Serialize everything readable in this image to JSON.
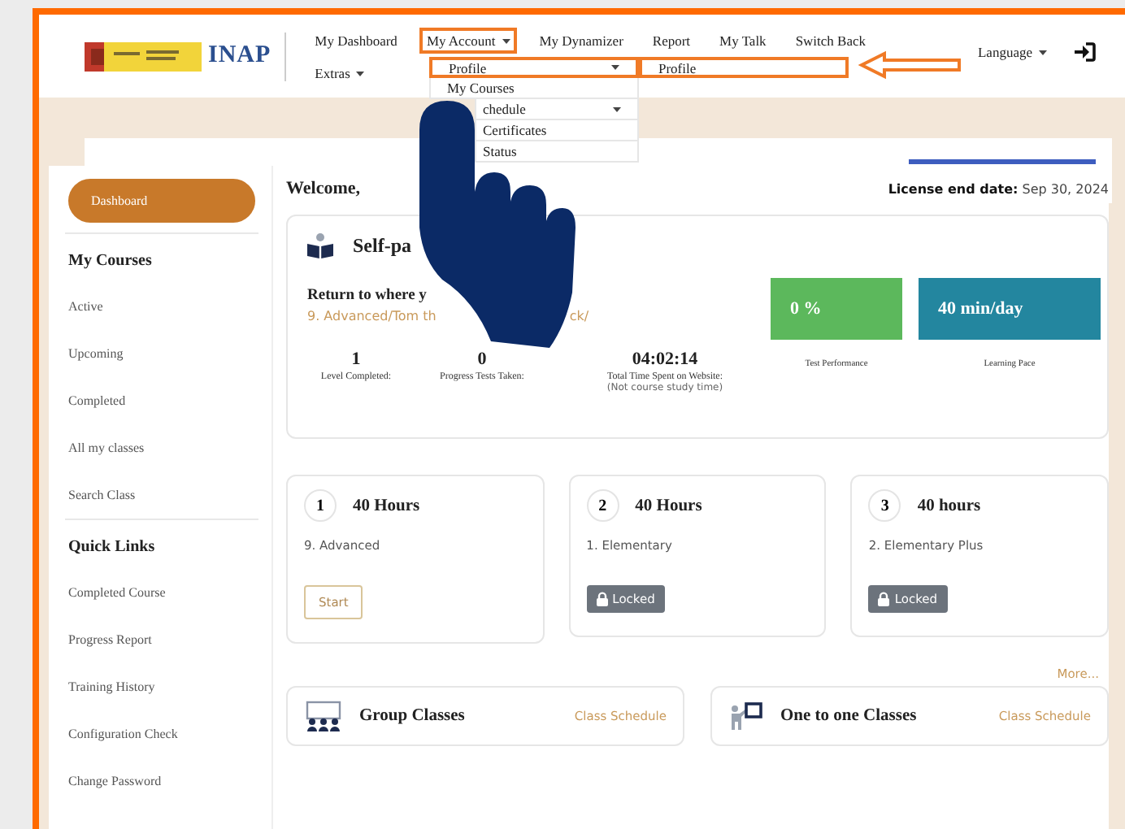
{
  "header": {
    "logo_text": "INAP",
    "nav": [
      {
        "label": "My Dashboard",
        "has_caret": false,
        "highlighted": false
      },
      {
        "label": "My Account",
        "has_caret": true,
        "highlighted": true
      },
      {
        "label": "My Dynamizer",
        "has_caret": false,
        "highlighted": false
      },
      {
        "label": "Report",
        "has_caret": false,
        "highlighted": false
      },
      {
        "label": "My Talk",
        "has_caret": false,
        "highlighted": false
      },
      {
        "label": "Switch Back",
        "has_caret": false,
        "highlighted": false
      }
    ],
    "nav_second_row": [
      {
        "label": "Extras",
        "has_caret": true,
        "highlighted": false
      }
    ],
    "language": "Language"
  },
  "dropdown": {
    "items": [
      {
        "label": "Profile",
        "has_caret": true,
        "highlighted": true,
        "covered": false
      },
      {
        "label": "My Courses",
        "has_caret": false,
        "highlighted": false,
        "covered": false
      },
      {
        "label": "chedule",
        "has_caret": true,
        "highlighted": false,
        "covered": true
      },
      {
        "label": "Certificates",
        "has_caret": false,
        "highlighted": false,
        "covered": true
      },
      {
        "label": "Status",
        "has_caret": false,
        "highlighted": false,
        "covered": true
      }
    ]
  },
  "submenu": {
    "items": [
      {
        "label": "Profile",
        "highlighted": true
      }
    ]
  },
  "sidebar": {
    "items": [
      {
        "label": "Dashboard",
        "selected": true
      }
    ],
    "sections": [
      {
        "heading": "My Courses",
        "items": [
          {
            "label": "Active",
            "selected": false
          },
          {
            "label": "Upcoming",
            "selected": false
          },
          {
            "label": "Completed",
            "selected": false
          },
          {
            "label": "All my classes",
            "selected": false
          },
          {
            "label": "Search Class",
            "selected": false
          }
        ]
      },
      {
        "heading": "Quick Links",
        "items": [
          {
            "label": "Completed Course",
            "selected": false
          },
          {
            "label": "Progress Report",
            "selected": false
          },
          {
            "label": "Training History",
            "selected": false
          },
          {
            "label": "Configuration Check",
            "selected": false
          },
          {
            "label": "Change Password",
            "selected": false
          }
        ]
      }
    ]
  },
  "welcome": "Welcome,",
  "license": {
    "label": "License end date:",
    "value": "Sep 30, 2024"
  },
  "self_paced": {
    "title": "Self-pa",
    "return_label": "Return to where y",
    "link_parts": [
      "9. Advanced/Tom th",
      "ck/"
    ],
    "stats": [
      {
        "value": "1",
        "label": "Level Completed:"
      },
      {
        "value": "0",
        "label": "Progress Tests Taken:"
      },
      {
        "value": "04:02:14",
        "label": "Total Time Spent on Website:",
        "note": "(Not course study time)"
      }
    ],
    "tiles": [
      {
        "value": "0 %",
        "label": "Test Performance",
        "color": "#5cb85c"
      },
      {
        "value": "40 min/day",
        "label": "Learning Pace",
        "color": "#23869f"
      }
    ]
  },
  "courses": [
    {
      "number": "1",
      "hours": "40 Hours",
      "name": "9. Advanced",
      "locked": false,
      "action": "Start"
    },
    {
      "number": "2",
      "hours": "40 Hours",
      "name": "1. Elementary",
      "locked": true,
      "action": "Locked"
    },
    {
      "number": "3",
      "hours": "40 hours",
      "name": "2. Elementary Plus",
      "locked": true,
      "action": "Locked"
    }
  ],
  "more": "More...",
  "classes": [
    {
      "kind": "group",
      "title": "Group Classes",
      "link": "Class Schedule"
    },
    {
      "kind": "one_to_one",
      "title": "One to one Classes",
      "link": "Class Schedule"
    }
  ]
}
